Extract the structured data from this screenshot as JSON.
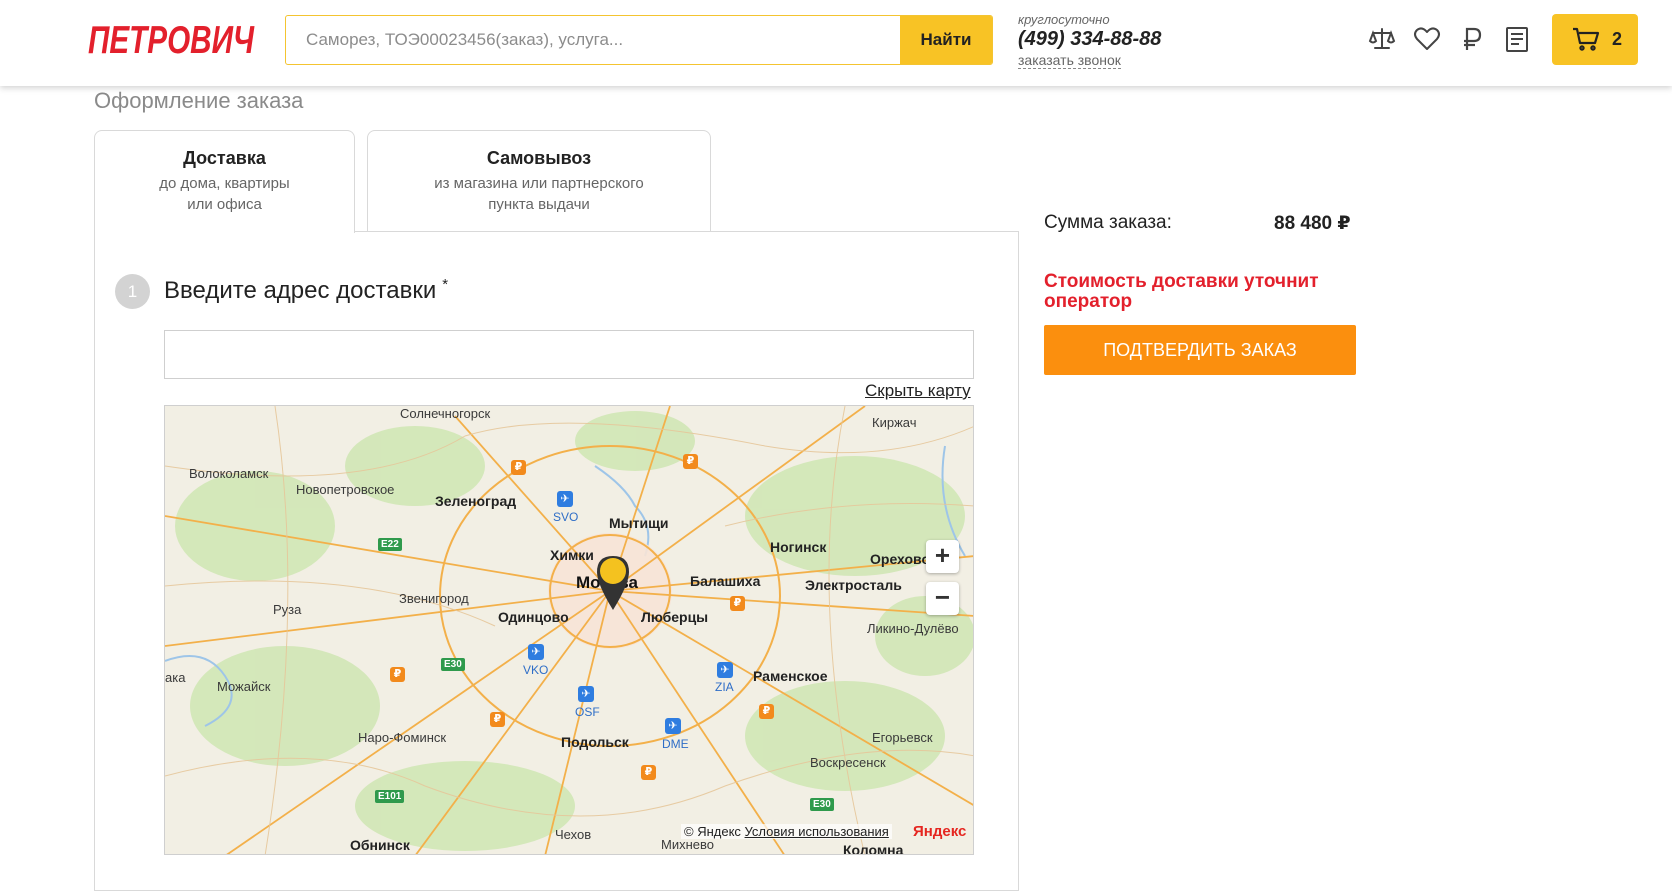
{
  "header": {
    "logo_text": "ПЕТРОВИЧ",
    "search": {
      "placeholder": "Саморез, ТОЭ00023456(заказ), услуга...",
      "value": "",
      "button_label": "Найти"
    },
    "phone": {
      "caption": "круглосуточно",
      "number": "(499) 334-88-88",
      "callback_label": "заказать звонок"
    },
    "icons": [
      "compare-scales-icon",
      "favorites-heart-icon",
      "ruble-icon",
      "orders-list-icon",
      "cart-icon"
    ],
    "cart_count": "2"
  },
  "page": {
    "title": "Оформление заказа"
  },
  "tabs": [
    {
      "title": "Доставка",
      "sub1": "до дома, квартиры",
      "sub2": "или офиса",
      "active": true
    },
    {
      "title": "Самовывоз",
      "sub1": "из магазина или партнерского",
      "sub2": "пункта выдачи",
      "active": false
    }
  ],
  "step": {
    "number": "1",
    "title": "Введите адрес доставки",
    "required_mark": "*",
    "address_value": "",
    "hide_map_label": "Скрыть карту"
  },
  "map": {
    "cities": {
      "solnechnogorsk": "Солнечногорск",
      "kirzhach": "Киржач",
      "volokolamsk": "Волоколамск",
      "novopetrovskoe": "Новопетровское",
      "zelenograd": "Зеленоград",
      "mytishchi": "Мытищи",
      "khimki": "Химки",
      "noginsk": "Ногинск",
      "orekhovo": "Орехово",
      "moskva": "Москва",
      "balashikha": "Балашиха",
      "elektrostal": "Электросталь",
      "ruza": "Руза",
      "zvenigorod": "Звенигород",
      "odintsovo": "Одинцово",
      "lyubertsy": "Люберцы",
      "likino": "Ликино-Дулёво",
      "mozhaysk": "Можайск",
      "ramenskoe": "Раменское",
      "naro": "Наро-Фоминск",
      "podolsk": "Подольск",
      "egorievsk": "Егорьевск",
      "voskresensk": "Воскресенск",
      "obninsk": "Обнинск",
      "chekhov": "Чехов",
      "mikhnevo": "Михнево",
      "kolomna": "Коломна",
      "edge_ka": "ака"
    },
    "airports": {
      "svo": "SVO",
      "vko": "VKO",
      "osf": "OSF",
      "dme": "DME",
      "zia": "ZIA"
    },
    "roads": {
      "e22": "E22",
      "e30a": "E30",
      "e30b": "E30",
      "e101": "E101"
    },
    "store_marker_glyph": "₽",
    "zoom_in": "+",
    "zoom_out": "−",
    "copyright": "© Яндекс",
    "terms_label": "Условия использования",
    "brand": "Яндекс"
  },
  "summary": {
    "sum_label": "Сумма заказа:",
    "sum_value": "88 480 ₽",
    "delivery_note": "Стоимость доставки уточнит оператор",
    "confirm_label": "ПОДТВЕРДИТЬ ЗАКАЗ"
  },
  "colors": {
    "accent_yellow": "#f8c325",
    "confirm_orange": "#fb8f0e",
    "brand_red": "#e3202c",
    "map_pin_yellow": "#f4c21f"
  }
}
